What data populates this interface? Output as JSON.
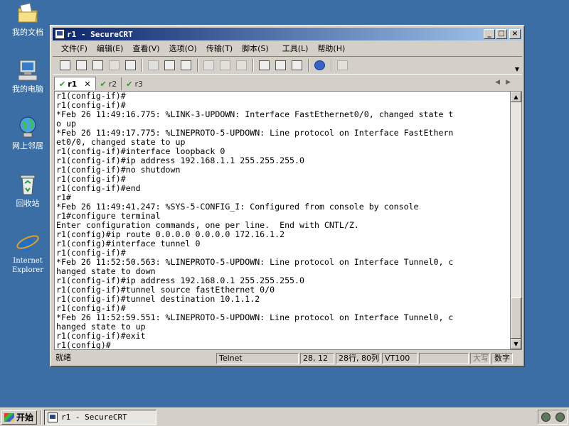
{
  "desktop": {
    "icons": [
      {
        "label": "我的文档"
      },
      {
        "label": "我的电脑"
      },
      {
        "label": "网上邻居"
      },
      {
        "label": "回收站"
      },
      {
        "label": "Internet Explorer"
      }
    ]
  },
  "window": {
    "title": "r1 - SecureCRT",
    "menu": [
      "文件(F)",
      "编辑(E)",
      "查看(V)",
      "选项(O)",
      "传输(T)",
      "脚本(S)",
      "工具(L)",
      "帮助(H)"
    ],
    "tabs": [
      {
        "label": "r1",
        "active": true
      },
      {
        "label": "r2",
        "active": false
      },
      {
        "label": "r3",
        "active": false
      }
    ],
    "tab_close": "✕"
  },
  "terminal": {
    "lines": [
      "r1(config-if)#",
      "r1(config-if)#",
      "*Feb 26 11:49:16.775: %LINK-3-UPDOWN: Interface FastEthernet0/0, changed state t",
      "o up",
      "*Feb 26 11:49:17.775: %LINEPROTO-5-UPDOWN: Line protocol on Interface FastEthern",
      "et0/0, changed state to up",
      "r1(config-if)#interface loopback 0",
      "r1(config-if)#ip address 192.168.1.1 255.255.255.0",
      "r1(config-if)#no shutdown",
      "r1(config-if)#",
      "r1(config-if)#end",
      "r1#",
      "*Feb 26 11:49:41.247: %SYS-5-CONFIG_I: Configured from console by console",
      "r1#configure terminal",
      "Enter configuration commands, one per line.  End with CNTL/Z.",
      "r1(config)#ip route 0.0.0.0 0.0.0.0 172.16.1.2",
      "r1(config)#interface tunnel 0",
      "r1(config-if)#",
      "*Feb 26 11:52:50.563: %LINEPROTO-5-UPDOWN: Line protocol on Interface Tunnel0, c",
      "hanged state to down",
      "r1(config-if)#ip address 192.168.0.1 255.255.255.0",
      "r1(config-if)#tunnel source fastEthernet 0/0",
      "r1(config-if)#tunnel destination 10.1.1.2",
      "r1(config-if)#",
      "*Feb 26 11:52:59.551: %LINEPROTO-5-UPDOWN: Line protocol on Interface Tunnel0, c",
      "hanged state to up",
      "r1(config-if)#exit",
      "r1(config)#"
    ]
  },
  "statusbar": {
    "ready": "就绪",
    "protocol": "Telnet",
    "cursor": "28, 12",
    "size": "28行, 80列",
    "emulation": "VT100",
    "blank": "",
    "caps": "大写",
    "num": "数字"
  },
  "taskbar": {
    "start_label": "开始",
    "task_label": "r1 - SecureCRT"
  }
}
